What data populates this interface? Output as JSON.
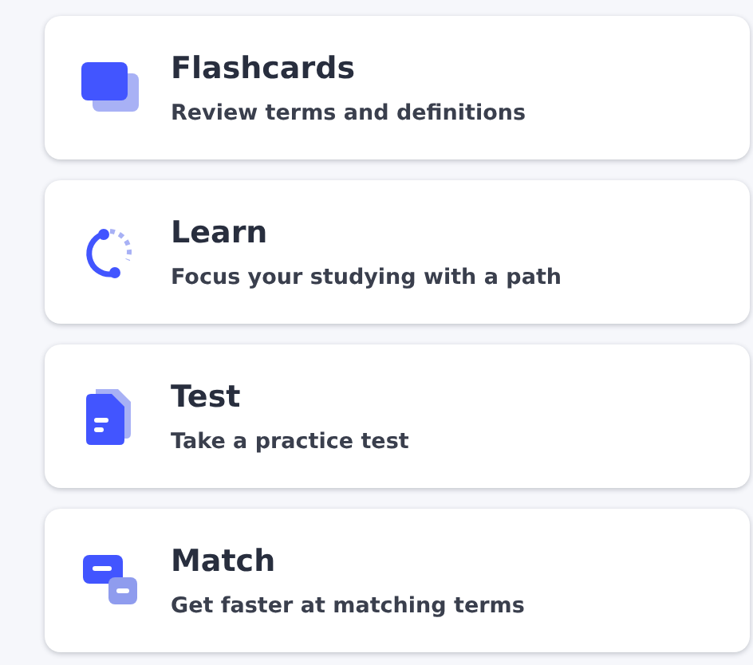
{
  "modes": [
    {
      "kind": "flashcards",
      "title": "Flashcards",
      "subtitle": "Review terms and definitions"
    },
    {
      "kind": "learn",
      "title": "Learn",
      "subtitle": "Focus your studying with a path"
    },
    {
      "kind": "test",
      "title": "Test",
      "subtitle": "Take a practice test"
    },
    {
      "kind": "match",
      "title": "Match",
      "subtitle": "Get faster at matching terms"
    }
  ]
}
